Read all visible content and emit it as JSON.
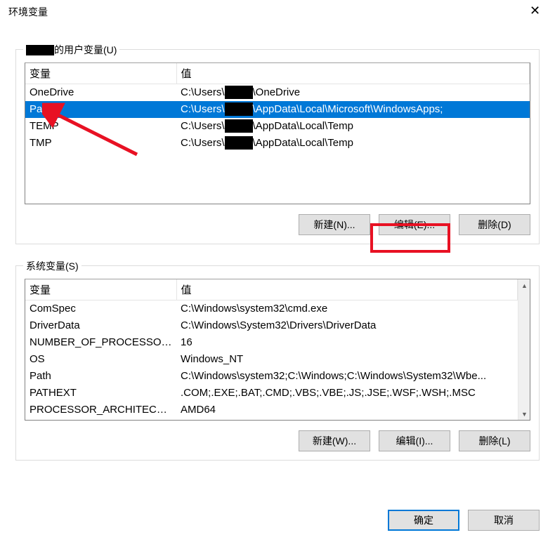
{
  "title": "环境变量",
  "closeGlyph": "✕",
  "userSection": {
    "legend_suffix": "的用户变量(U)",
    "columns": {
      "var": "变量",
      "value": "值"
    },
    "rows": [
      {
        "var": "OneDrive",
        "value_pre": "C:\\Users\\",
        "value_post": "\\OneDrive",
        "selected": false
      },
      {
        "var": "Path",
        "value_pre": "C:\\Users\\",
        "value_post": "\\AppData\\Local\\Microsoft\\WindowsApps;",
        "selected": true
      },
      {
        "var": "TEMP",
        "value_pre": "C:\\Users\\",
        "value_post": "\\AppData\\Local\\Temp",
        "selected": false
      },
      {
        "var": "TMP",
        "value_pre": "C:\\Users\\",
        "value_post": "\\AppData\\Local\\Temp",
        "selected": false
      }
    ],
    "buttons": {
      "new": "新建(N)...",
      "edit": "编辑(E)...",
      "delete": "删除(D)"
    }
  },
  "systemSection": {
    "legend": "系统变量(S)",
    "columns": {
      "var": "变量",
      "value": "值"
    },
    "rows": [
      {
        "var": "ComSpec",
        "value": "C:\\Windows\\system32\\cmd.exe"
      },
      {
        "var": "DriverData",
        "value": "C:\\Windows\\System32\\Drivers\\DriverData"
      },
      {
        "var": "NUMBER_OF_PROCESSORS",
        "value": "16"
      },
      {
        "var": "OS",
        "value": "Windows_NT"
      },
      {
        "var": "Path",
        "value": "C:\\Windows\\system32;C:\\Windows;C:\\Windows\\System32\\Wbe..."
      },
      {
        "var": "PATHEXT",
        "value": ".COM;.EXE;.BAT;.CMD;.VBS;.VBE;.JS;.JSE;.WSF;.WSH;.MSC"
      },
      {
        "var": "PROCESSOR_ARCHITECTURE",
        "value": "AMD64"
      }
    ],
    "buttons": {
      "new": "新建(W)...",
      "edit": "编辑(I)...",
      "delete": "删除(L)"
    }
  },
  "dialog": {
    "ok": "确定",
    "cancel": "取消"
  }
}
